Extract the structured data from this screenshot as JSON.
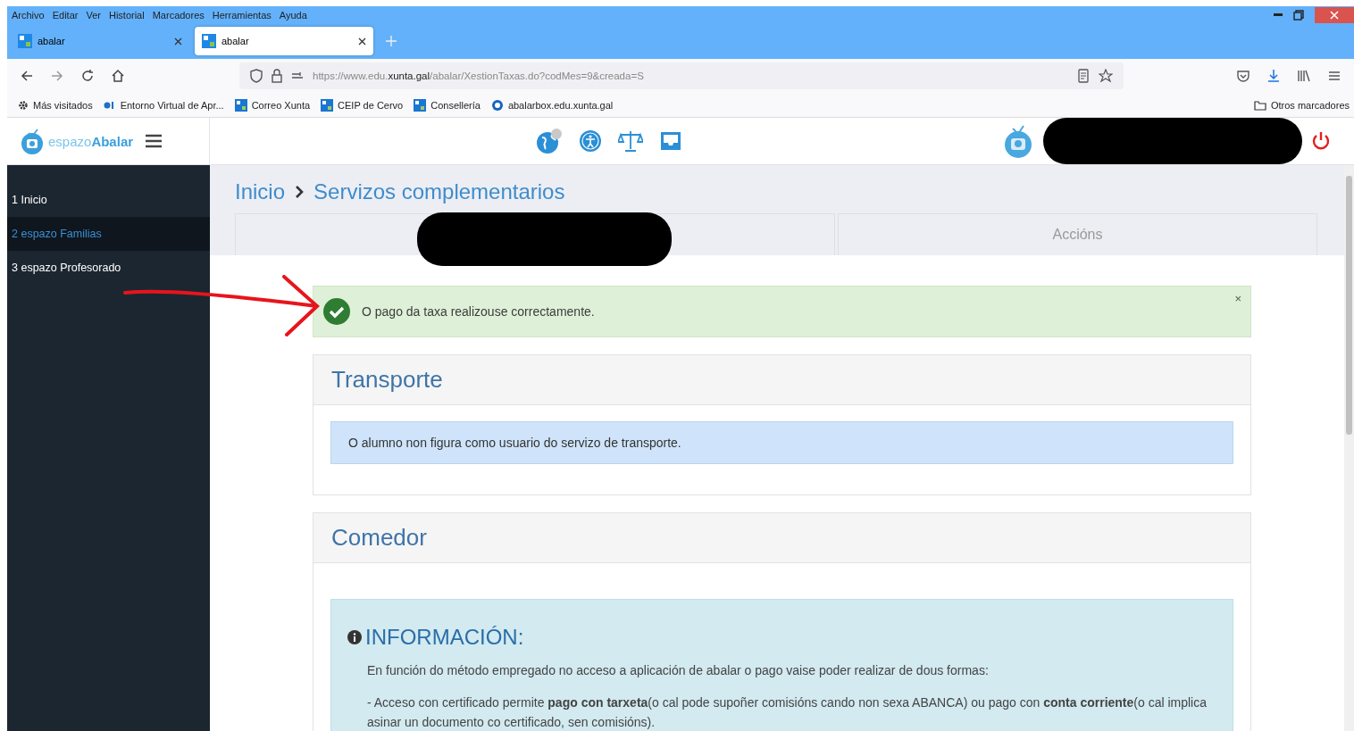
{
  "menu_bar": [
    "Archivo",
    "Editar",
    "Ver",
    "Historial",
    "Marcadores",
    "Herramientas",
    "Ayuda"
  ],
  "browser_tabs": [
    {
      "title": "abalar",
      "selected": false
    },
    {
      "title": "abalar",
      "selected": true
    }
  ],
  "address_bar": {
    "url_prefix": "https://www.edu.",
    "url_domain": "xunta.gal",
    "url_path": "/abalar/XestionTaxas.do?codMes=9&creada=S"
  },
  "bookmarks": [
    {
      "label": "Más visitados",
      "kind": "gear"
    },
    {
      "label": "Entorno Virtual de Apr...",
      "kind": "eva"
    },
    {
      "label": "Correo Xunta",
      "kind": "tile"
    },
    {
      "label": "CEIP de Cervo",
      "kind": "tile"
    },
    {
      "label": "Consellería",
      "kind": "tile"
    },
    {
      "label": "abalarbox.edu.xunta.gal",
      "kind": "ring"
    }
  ],
  "other_bookmarks": "Otros marcadores",
  "app": {
    "logo_prefix": "espazo",
    "logo_name": "Abalar"
  },
  "sidebar": {
    "items": [
      {
        "label": "1 Inicio",
        "selected": false
      },
      {
        "label": "2 espazo Familias",
        "selected": true
      },
      {
        "label": "3 espazo Profesorado",
        "selected": false
      }
    ]
  },
  "breadcrumb": [
    "Inicio",
    "Servizos complementarios"
  ],
  "content_tabs": [
    {
      "kind": "redacted"
    },
    {
      "kind": "text",
      "label": "Accións"
    }
  ],
  "alert": {
    "message": "O pago da taxa realizouse correctamente.",
    "close": "×"
  },
  "panels": [
    {
      "title": "Transporte",
      "kind": "notice",
      "message": "O alumno non figura como usuario do servizo de transporte."
    },
    {
      "title": "Comedor",
      "kind": "info",
      "heading": "INFORMACIÓN:",
      "paragraphs": [
        "En función do método empregado no acceso a aplicación de abalar o pago vaise poder realizar de dous formas:",
        "- Acceso con certificado permite **pago con tarxeta**(o cal pode supoñer comisións cando non sexa ABANCA) ou pago con **conta corriente**(o cal implica asinar un documento co certificado, sen comisións)."
      ]
    }
  ]
}
